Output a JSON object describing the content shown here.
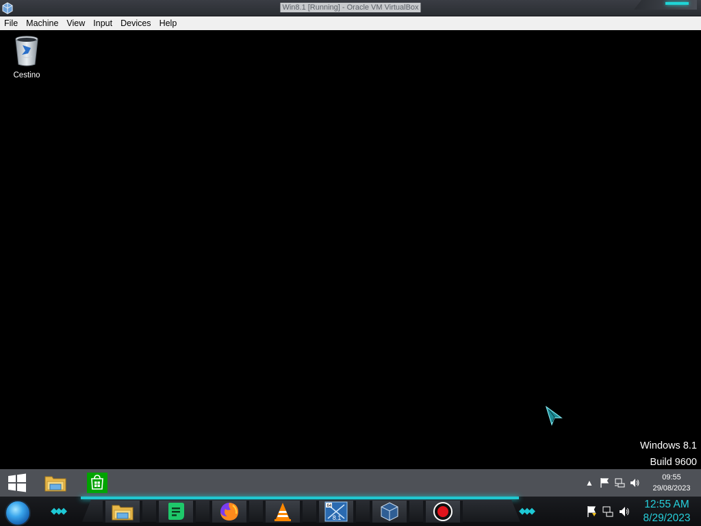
{
  "host_window": {
    "title": "Win8.1 [Running] - Oracle VM VirtualBox",
    "menu": [
      "File",
      "Machine",
      "View",
      "Input",
      "Devices",
      "Help"
    ]
  },
  "desktop": {
    "icons": [
      {
        "label": "Cestino",
        "icon": "recycle-bin-icon"
      }
    ],
    "watermark": {
      "os": "Windows 8.1",
      "build": "Build 9600"
    }
  },
  "guest_taskbar": {
    "pinned": [
      {
        "name": "start",
        "icon": "windows-logo-icon"
      },
      {
        "name": "file-explorer",
        "icon": "folder-icon"
      },
      {
        "name": "store",
        "icon": "store-icon"
      }
    ],
    "tray": {
      "icons": [
        "show-hidden-icons-icon",
        "action-center-flag-icon",
        "network-icon",
        "volume-icon"
      ],
      "time": "09:55",
      "date": "29/08/2023"
    }
  },
  "host_dock": {
    "apps": [
      {
        "name": "file-explorer",
        "icon": "folder-icon"
      },
      {
        "name": "notes",
        "icon": "notes-icon"
      },
      {
        "name": "firefox",
        "icon": "firefox-icon"
      },
      {
        "name": "vlc",
        "icon": "vlc-icon"
      },
      {
        "name": "virtualbox-vm",
        "icon": "virtualbox-vm-icon",
        "badge": "8.1",
        "corner": "64"
      },
      {
        "name": "virtualbox",
        "icon": "virtualbox-icon"
      },
      {
        "name": "recorder",
        "icon": "record-icon"
      }
    ],
    "tray": {
      "icons": [
        "action-center-flag-icon",
        "network-icon",
        "volume-icon"
      ],
      "time": "12:55 AM",
      "date": "8/29/2023"
    }
  },
  "colors": {
    "accent": "#20d4d6",
    "desktop_bg": "#000000",
    "guest_taskbar": "#4e5157",
    "menubar": "#f0f0f0"
  }
}
